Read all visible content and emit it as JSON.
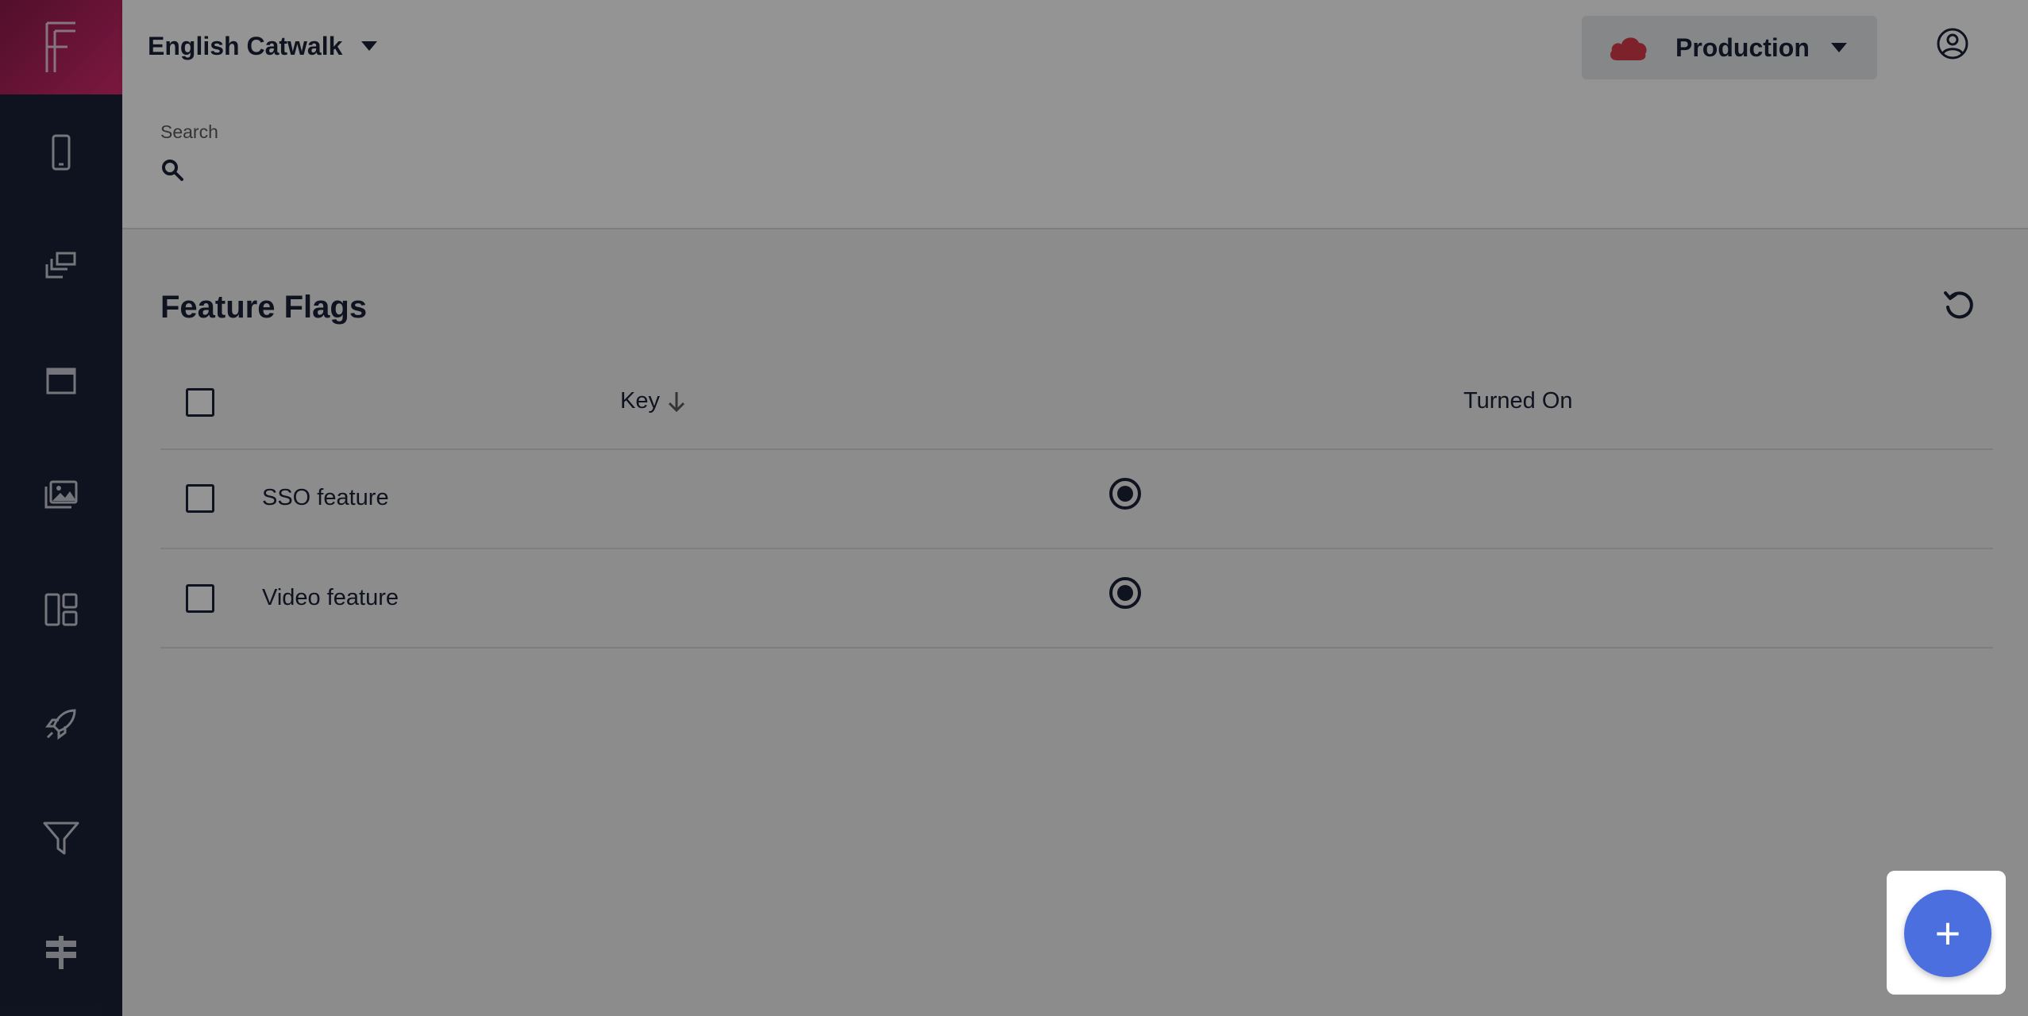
{
  "project": {
    "name": "English Catwalk"
  },
  "environment": {
    "name": "Production",
    "cloud_color": "#d8394a"
  },
  "sidebar": {
    "logo": "F",
    "items": [
      {
        "icon": "smartphone-icon"
      },
      {
        "icon": "copy-icon"
      },
      {
        "icon": "window-icon"
      },
      {
        "icon": "images-icon"
      },
      {
        "icon": "dashboard-icon"
      },
      {
        "icon": "rocket-icon"
      },
      {
        "icon": "filter-icon"
      },
      {
        "icon": "signpost-icon"
      }
    ]
  },
  "search": {
    "label": "Search",
    "value": ""
  },
  "main": {
    "title": "Feature Flags",
    "columns": {
      "key": "Key",
      "turned_on": "Turned On"
    },
    "rows": [
      {
        "key": "SSO feature",
        "turned_on": true
      },
      {
        "key": "Video feature",
        "turned_on": true
      }
    ]
  },
  "fab": {
    "label": "+"
  },
  "colors": {
    "sidebar_bg": "#1a2238",
    "logo_gradient_start": "#8c1a4a",
    "logo_gradient_end": "#d42a6e",
    "accent": "#4c6fe0",
    "text": "#1a2238"
  }
}
